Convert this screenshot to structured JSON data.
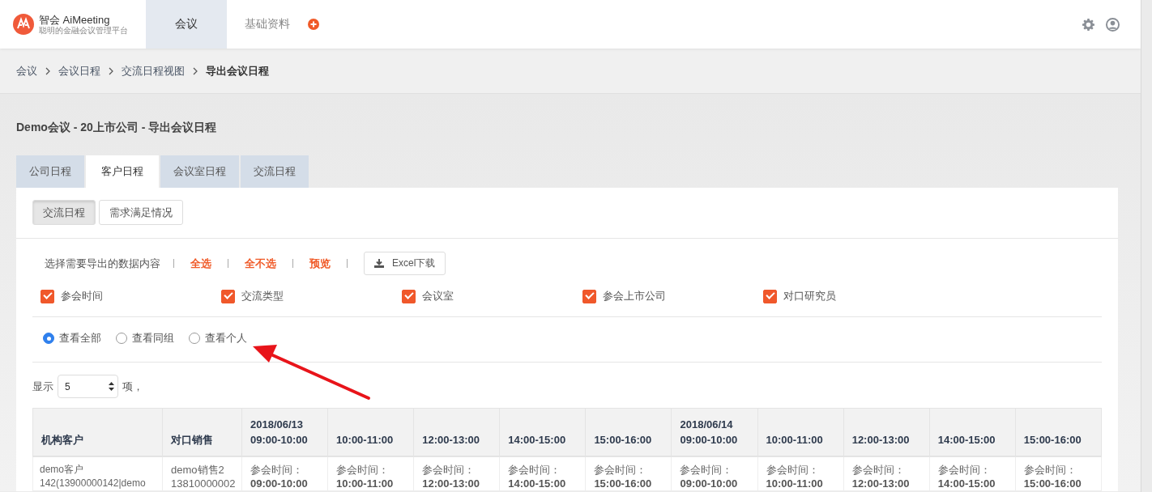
{
  "brand": {
    "name": "智会 AiMeeting",
    "tagline": "聪明的金融会议管理平台"
  },
  "nav": [
    {
      "label": "会议",
      "selected": true
    },
    {
      "label": "基础资料",
      "selected": false
    }
  ],
  "breadcrumb": [
    "会议",
    "会议日程",
    "交流日程视图",
    "导出会议日程"
  ],
  "page_title": "Demo会议 - 20上市公司 - 导出会议日程",
  "tabs": [
    {
      "label": "公司日程",
      "selected": false
    },
    {
      "label": "客户日程",
      "selected": true
    },
    {
      "label": "会议室日程",
      "selected": false
    },
    {
      "label": "交流日程",
      "selected": false
    }
  ],
  "subtabs": [
    {
      "label": "交流日程",
      "selected": true
    },
    {
      "label": "需求满足情况",
      "selected": false
    }
  ],
  "export": {
    "prompt": "选择需要导出的数据内容",
    "actions": [
      "全选",
      "全不选",
      "预览"
    ],
    "download": "Excel下载"
  },
  "fields": [
    {
      "label": "参会时间",
      "checked": true
    },
    {
      "label": "交流类型",
      "checked": true
    },
    {
      "label": "会议室",
      "checked": true
    },
    {
      "label": "参会上市公司",
      "checked": true
    },
    {
      "label": "对口研究员",
      "checked": true
    }
  ],
  "scope": [
    {
      "label": "查看全部",
      "selected": true
    },
    {
      "label": "查看同组",
      "selected": false
    },
    {
      "label": "查看个人",
      "selected": false
    }
  ],
  "page_size": {
    "prefix": "显示",
    "value": "5",
    "suffix": "项，"
  },
  "table": {
    "columns": [
      {
        "label": "机构客户"
      },
      {
        "label": "对口销售"
      },
      {
        "date": "2018/06/13",
        "label": "09:00-10:00"
      },
      {
        "label": "10:00-11:00"
      },
      {
        "label": "12:00-13:00"
      },
      {
        "label": "14:00-15:00"
      },
      {
        "label": "15:00-16:00"
      },
      {
        "date": "2018/06/14",
        "label": "09:00-10:00"
      },
      {
        "label": "10:00-11:00"
      },
      {
        "label": "12:00-13:00"
      },
      {
        "label": "14:00-15:00"
      },
      {
        "label": "15:00-16:00"
      }
    ],
    "rows": [
      {
        "client": [
          "demo客户",
          "142(13900000142|demo"
        ],
        "sales": [
          "demo销售2",
          "13810000002"
        ],
        "slots": [
          {
            "label": "参会时间：",
            "time": "09:00-10:00"
          },
          {
            "label": "参会时间：",
            "time": "10:00-11:00"
          },
          {
            "label": "参会时间：",
            "time": "12:00-13:00"
          },
          {
            "label": "参会时间：",
            "time": "14:00-15:00"
          },
          {
            "label": "参会时间：",
            "time": "15:00-16:00"
          },
          {
            "label": "参会时间：",
            "time": "09:00-10:00"
          },
          {
            "label": "参会时间：",
            "time": "10:00-11:00"
          },
          {
            "label": "参会时间：",
            "time": "12:00-13:00"
          },
          {
            "label": "参会时间：",
            "time": "14:00-15:00"
          },
          {
            "label": "参会时间：",
            "time": "15:00-16:00"
          }
        ]
      }
    ]
  }
}
